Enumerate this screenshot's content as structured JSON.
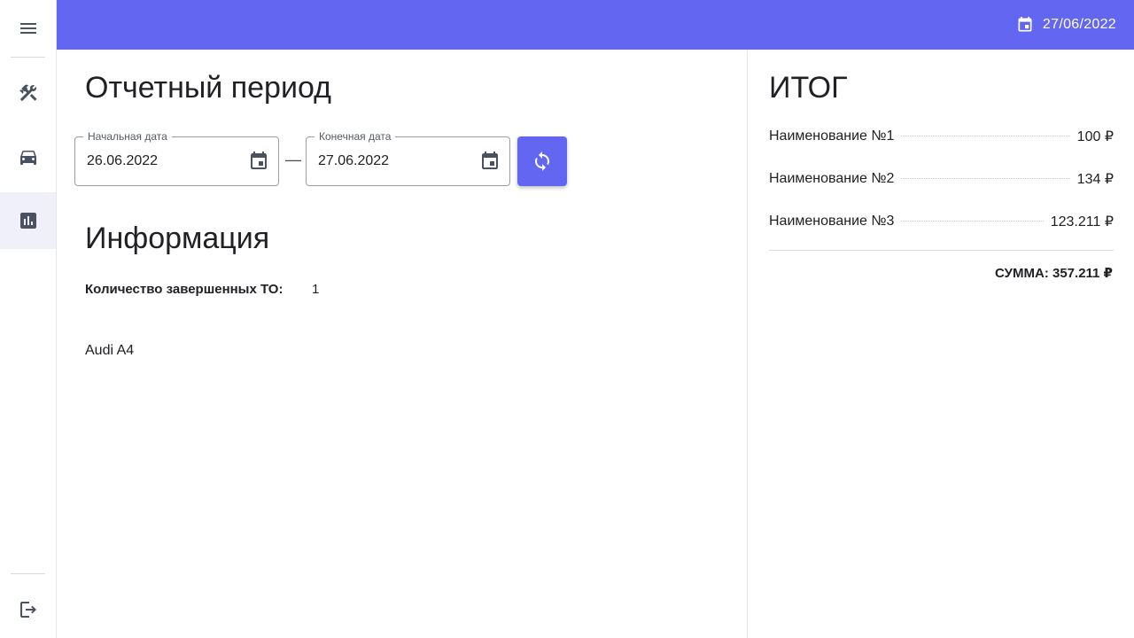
{
  "topbar": {
    "date": "27/06/2022"
  },
  "sidebar": {
    "items": [
      {
        "name": "menu",
        "icon": "menu-icon"
      },
      {
        "name": "services",
        "icon": "tools-icon"
      },
      {
        "name": "cars",
        "icon": "car-icon"
      },
      {
        "name": "reports",
        "icon": "bar-chart-icon",
        "active": true
      },
      {
        "name": "logout",
        "icon": "logout-icon"
      }
    ]
  },
  "main": {
    "period_title": "Отчетный период",
    "start_date": {
      "label": "Начальная дата",
      "value": "26.06.2022"
    },
    "end_date": {
      "label": "Конечная дата",
      "value": "27.06.2022"
    },
    "separator": "—",
    "info_title": "Информация",
    "completed_label": "Количество завершенных ТО:",
    "completed_value": "1",
    "car": "Audi A4"
  },
  "totals": {
    "title": "ИТОГ",
    "items": [
      {
        "name": "Наименование №1",
        "amount": "100 ₽"
      },
      {
        "name": "Наименование №2",
        "amount": "134 ₽"
      },
      {
        "name": "Наименование №3",
        "amount": "123.211 ₽"
      }
    ],
    "sum": "СУММА: 357.211 ₽"
  },
  "colors": {
    "accent": "#6366f1",
    "sidebar_active": "#f0f0fa",
    "icon": "#4a5160"
  }
}
